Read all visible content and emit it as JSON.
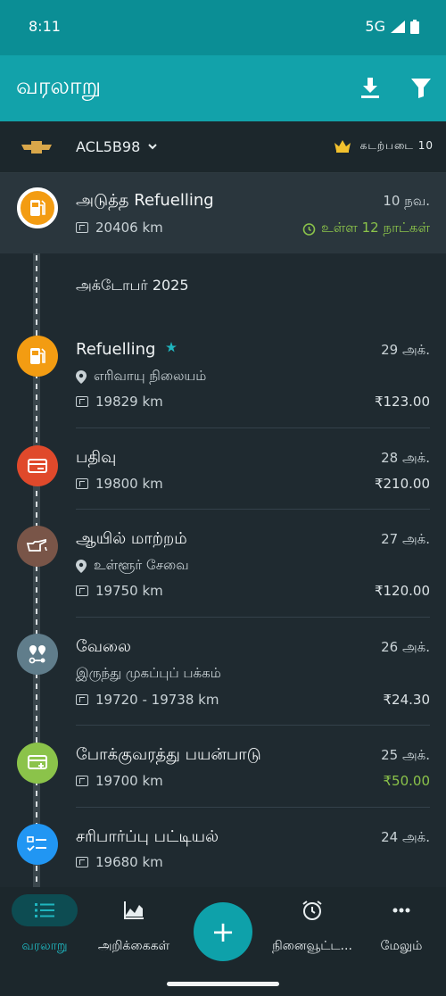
{
  "status": {
    "time": "8:11",
    "network": "5G"
  },
  "app_bar": {
    "title": "வரலாறு"
  },
  "vehicle": {
    "name": "ACL5B98",
    "plan": "கடற்படை 10"
  },
  "next_entry": {
    "title": "அடுத்த Refuelling",
    "date": "10 நவ.",
    "odometer": "20406 km",
    "due": "உள்ள 12 நாட்கள்"
  },
  "month": "அக்டோபர் 2025",
  "entries": [
    {
      "title": "Refuelling",
      "date": "29 அக்.",
      "location": "எரிவாயு நிலையம்",
      "odometer": "19829 km",
      "amount": "₹123.00"
    },
    {
      "title": "பதிவு",
      "date": "28 அக்.",
      "odometer": "19800 km",
      "amount": "₹210.00"
    },
    {
      "title": "ஆயில் மாற்றம்",
      "date": "27 அக்.",
      "location": "உள்ளூர் சேவை",
      "odometer": "19750 km",
      "amount": "₹120.00"
    },
    {
      "title": "வேலை",
      "date": "26 அக்.",
      "location": "இருந்து முகப்புப் பக்கம்",
      "odometer": "19720 - 19738 km",
      "amount": "₹24.30"
    },
    {
      "title": "போக்குவரத்து பயன்பாடு",
      "date": "25 அக்.",
      "odometer": "19700 km",
      "amount": "₹50.00"
    },
    {
      "title": "சரிபார்ப்பு பட்டியல்",
      "date": "24 அக்.",
      "odometer": "19680 km"
    }
  ],
  "nav": [
    {
      "label": "வரலாறு",
      "icon": "list-icon"
    },
    {
      "label": "அறிக்கைகள்",
      "icon": "chart-icon"
    },
    {
      "label": "நினைவூட்ட...",
      "icon": "alarm-icon"
    },
    {
      "label": "மேலும்",
      "icon": "more-icon"
    }
  ],
  "fab": {
    "icon": "+"
  },
  "colors": {
    "accent": "#12a2aa",
    "fuel": "#f39c12",
    "expense": "#e0492b",
    "service": "#795548",
    "trip": "#607d8b",
    "income": "#8bc34a",
    "checklist": "#2196f3"
  }
}
